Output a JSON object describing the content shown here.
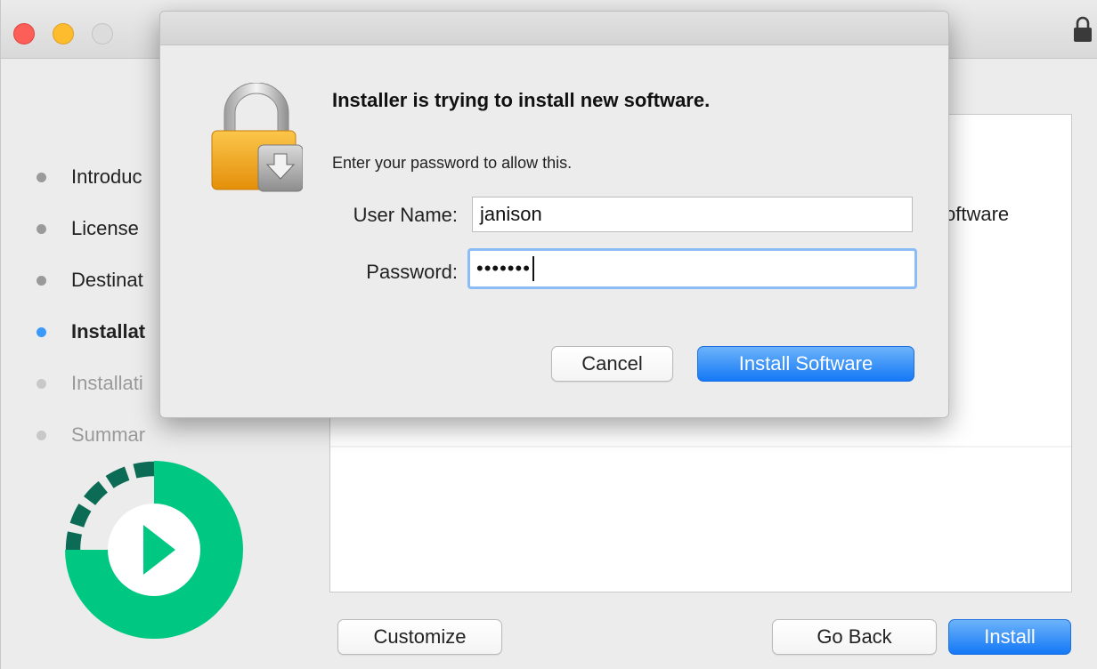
{
  "window": {
    "steps": [
      {
        "label": "Introduc",
        "state": "done"
      },
      {
        "label": "License",
        "state": "done"
      },
      {
        "label": "Destinat",
        "state": "done"
      },
      {
        "label": "Installat",
        "state": "active"
      },
      {
        "label": "Installati",
        "state": "future"
      },
      {
        "label": "Summar",
        "state": "future"
      }
    ],
    "content_text": "oftware",
    "buttons": {
      "customize": "Customize",
      "go_back": "Go Back",
      "install": "Install"
    }
  },
  "dialog": {
    "title": "Installer is trying to install new software.",
    "subtitle": "Enter your password to allow this.",
    "user_label": "User Name:",
    "user_value": "janison",
    "password_label": "Password:",
    "password_mask": "•••••••",
    "cancel_label": "Cancel",
    "confirm_label": "Install Software"
  },
  "colors": {
    "accent": "#3b99fc",
    "logo_green": "#00c882",
    "logo_dark": "#0b6b55",
    "lock_gold": "#f3a81c"
  },
  "icons": {
    "top_right": "lock-icon",
    "dialog": "padlock-installer-icon",
    "logo": "installer-logo"
  }
}
